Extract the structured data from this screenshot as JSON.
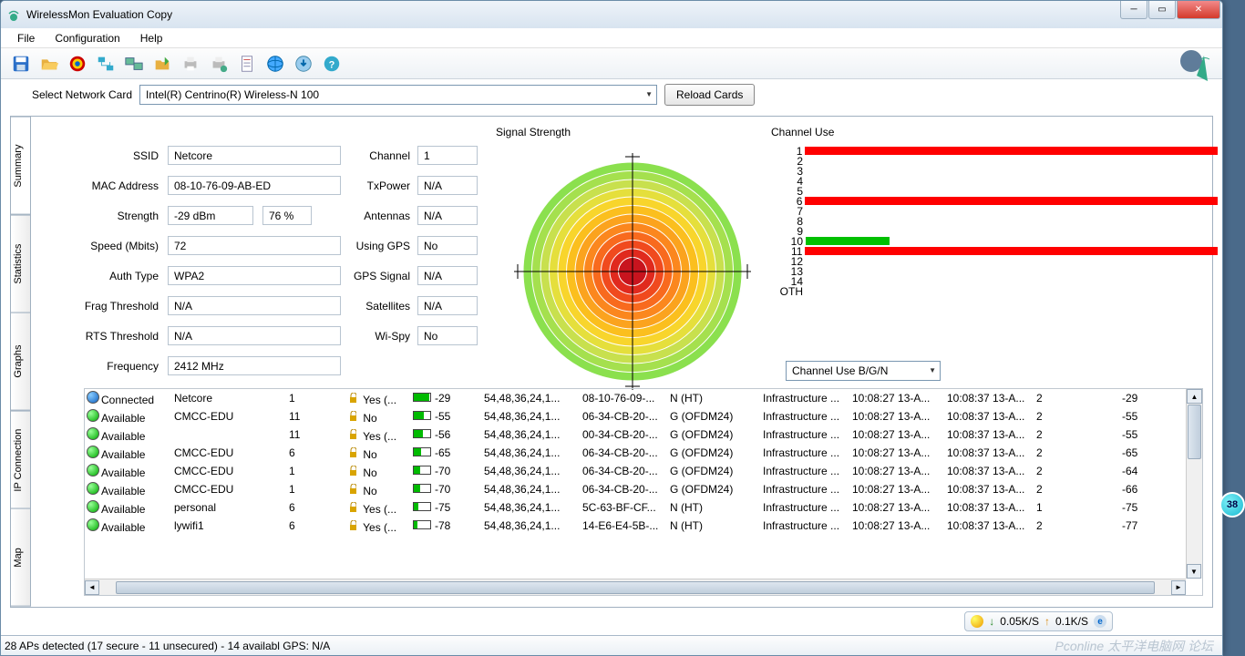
{
  "window": {
    "title": "WirelessMon Evaluation Copy"
  },
  "menu": [
    "File",
    "Configuration",
    "Help"
  ],
  "selcard": {
    "label": "Select Network Card",
    "value": "Intel(R) Centrino(R) Wireless-N 100",
    "reload": "Reload Cards"
  },
  "vtabs": [
    "Summary",
    "Statistics",
    "Graphs",
    "IP Connection",
    "Map"
  ],
  "fields_left": [
    {
      "label": "SSID",
      "value": "Netcore",
      "w": 190
    },
    {
      "label": "MAC Address",
      "value": "08-10-76-09-AB-ED",
      "w": 190
    },
    {
      "label": "Strength",
      "value": "-29 dBm",
      "w": 94,
      "value2": "76 %",
      "w2": 54
    },
    {
      "label": "Speed (Mbits)",
      "value": "72",
      "w": 190
    },
    {
      "label": "Auth Type",
      "value": "WPA2",
      "w": 190
    },
    {
      "label": "Frag Threshold",
      "value": "N/A",
      "w": 190
    },
    {
      "label": "RTS Threshold",
      "value": "N/A",
      "w": 190
    },
    {
      "label": "Frequency",
      "value": "2412 MHz",
      "w": 190
    }
  ],
  "fields_right": [
    {
      "label": "Channel",
      "value": "1"
    },
    {
      "label": "TxPower",
      "value": "N/A"
    },
    {
      "label": "Antennas",
      "value": "N/A"
    },
    {
      "label": "Using GPS",
      "value": "No"
    },
    {
      "label": "GPS Signal",
      "value": "N/A"
    },
    {
      "label": "Satellites",
      "value": "N/A"
    },
    {
      "label": "Wi-Spy",
      "value": "No"
    }
  ],
  "sections": {
    "signal": "Signal Strength",
    "channel": "Channel Use"
  },
  "chart_data": {
    "type": "bar",
    "title": "Channel Use",
    "categories": [
      "1",
      "2",
      "3",
      "4",
      "5",
      "6",
      "7",
      "8",
      "9",
      "10",
      "11",
      "12",
      "13",
      "14",
      "OTH"
    ],
    "max": 100,
    "series": [
      {
        "channel": "1",
        "pct": 100,
        "color": "red"
      },
      {
        "channel": "2",
        "pct": 0
      },
      {
        "channel": "3",
        "pct": 0
      },
      {
        "channel": "4",
        "pct": 0
      },
      {
        "channel": "5",
        "pct": 0
      },
      {
        "channel": "6",
        "pct": 100,
        "color": "red"
      },
      {
        "channel": "7",
        "pct": 0
      },
      {
        "channel": "8",
        "pct": 0
      },
      {
        "channel": "9",
        "pct": 0
      },
      {
        "channel": "10",
        "pct": 20,
        "color": "green"
      },
      {
        "channel": "11",
        "pct": 100,
        "color": "red"
      },
      {
        "channel": "12",
        "pct": 0
      },
      {
        "channel": "13",
        "pct": 0
      },
      {
        "channel": "14",
        "pct": 0
      },
      {
        "channel": "OTH",
        "pct": 0
      }
    ]
  },
  "chcombo": "Channel Use B/G/N",
  "networks": [
    {
      "status": "Connected",
      "ico": "blue",
      "ssid": "Netcore",
      "ch": "1",
      "sec": "Yes (...",
      "lock": true,
      "rssi": "-29",
      "bar": 95,
      "rates": "54,48,36,24,1...",
      "mac": "08-10-76-09-...",
      "net": "N (HT)",
      "infra": "Infrastructure ...",
      "first": "10:08:27 13-A...",
      "last": "10:08:37 13-A...",
      "nch": "2",
      "rssi2": "-29"
    },
    {
      "status": "Available",
      "ico": "green",
      "ssid": "CMCC-EDU",
      "ch": "11",
      "sec": "No",
      "lock": true,
      "rssi": "-55",
      "bar": 60,
      "rates": "54,48,36,24,1...",
      "mac": "06-34-CB-20-...",
      "net": "G (OFDM24)",
      "infra": "Infrastructure ...",
      "first": "10:08:27 13-A...",
      "last": "10:08:37 13-A...",
      "nch": "2",
      "rssi2": "-55"
    },
    {
      "status": "Available",
      "ico": "green",
      "ssid": "",
      "ch": "11",
      "sec": "Yes (...",
      "lock": true,
      "rssi": "-56",
      "bar": 58,
      "rates": "54,48,36,24,1...",
      "mac": "00-34-CB-20-...",
      "net": "G (OFDM24)",
      "infra": "Infrastructure ...",
      "first": "10:08:27 13-A...",
      "last": "10:08:37 13-A...",
      "nch": "2",
      "rssi2": "-55"
    },
    {
      "status": "Available",
      "ico": "green",
      "ssid": "CMCC-EDU",
      "ch": "6",
      "sec": "No",
      "lock": true,
      "rssi": "-65",
      "bar": 45,
      "rates": "54,48,36,24,1...",
      "mac": "06-34-CB-20-...",
      "net": "G (OFDM24)",
      "infra": "Infrastructure ...",
      "first": "10:08:27 13-A...",
      "last": "10:08:37 13-A...",
      "nch": "2",
      "rssi2": "-65"
    },
    {
      "status": "Available",
      "ico": "green",
      "ssid": "CMCC-EDU",
      "ch": "1",
      "sec": "No",
      "lock": true,
      "rssi": "-70",
      "bar": 38,
      "rates": "54,48,36,24,1...",
      "mac": "06-34-CB-20-...",
      "net": "G (OFDM24)",
      "infra": "Infrastructure ...",
      "first": "10:08:27 13-A...",
      "last": "10:08:37 13-A...",
      "nch": "2",
      "rssi2": "-64"
    },
    {
      "status": "Available",
      "ico": "green",
      "ssid": "CMCC-EDU",
      "ch": "1",
      "sec": "No",
      "lock": true,
      "rssi": "-70",
      "bar": 38,
      "rates": "54,48,36,24,1...",
      "mac": "06-34-CB-20-...",
      "net": "G (OFDM24)",
      "infra": "Infrastructure ...",
      "first": "10:08:27 13-A...",
      "last": "10:08:37 13-A...",
      "nch": "2",
      "rssi2": "-66"
    },
    {
      "status": "Available",
      "ico": "green",
      "ssid": "personal",
      "ch": "6",
      "sec": "Yes (...",
      "lock": true,
      "rssi": "-75",
      "bar": 28,
      "rates": "54,48,36,24,1...",
      "mac": "5C-63-BF-CF...",
      "net": "N (HT)",
      "infra": "Infrastructure ...",
      "first": "10:08:27 13-A...",
      "last": "10:08:37 13-A...",
      "nch": "1",
      "rssi2": "-75"
    },
    {
      "status": "Available",
      "ico": "green",
      "ssid": "lywifi1",
      "ch": "6",
      "sec": "Yes (...",
      "lock": true,
      "rssi": "-78",
      "bar": 22,
      "rates": "54,48,36,24,1...",
      "mac": "14-E6-E4-5B-...",
      "net": "N (HT)",
      "infra": "Infrastructure ...",
      "first": "10:08:27 13-A...",
      "last": "10:08:37 13-A...",
      "nch": "2",
      "rssi2": "-77"
    }
  ],
  "status": "28 APs detected (17 secure - 11 unsecured) - 14 availabl GPS: N/A",
  "netmeter": {
    "down": "0.05K/S",
    "up": "0.1K/S"
  },
  "watermark": "Pconline 太平洋电脑网 论坛",
  "bubble": "38"
}
